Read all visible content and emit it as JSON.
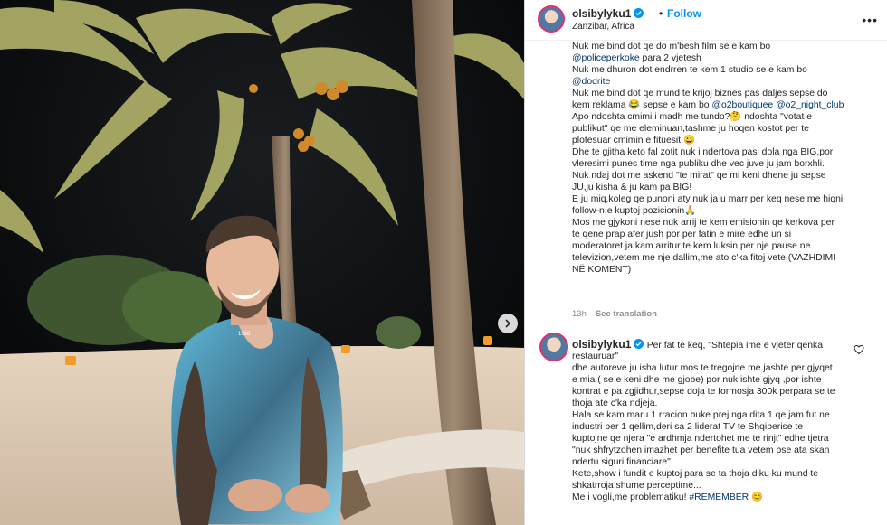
{
  "post": {
    "username": "olsibylyku1",
    "follow_label": "Follow",
    "location": "Zanzibar, Africa",
    "time": "13h",
    "see_translation": "See translation",
    "caption_lines": [
      [
        {
          "t": "Nuk me bind dot qe do m'besh film se e kam bo"
        }
      ],
      [
        {
          "t": "@policeperkoke",
          "m": true
        },
        {
          "t": " para 2 vjetesh"
        }
      ],
      [
        {
          "t": "Nuk me dhuron dot endrren te kem 1 studio se e kam bo"
        }
      ],
      [
        {
          "t": "@dodrite",
          "m": true
        }
      ],
      [
        {
          "t": "Nuk me bind dot qe mund te krijoj biznes pas daljes sepse do"
        }
      ],
      [
        {
          "t": "kem reklama 😂 sepse e kam bo "
        },
        {
          "t": "@o2boutiquee",
          "m": true
        },
        {
          "t": " "
        },
        {
          "t": "@o2_night_club",
          "m": true
        }
      ],
      [
        {
          "t": "Apo ndoshta cmimi i madh me tundo?🤔 ndoshta \"votat e"
        }
      ],
      [
        {
          "t": "publikut\" qe me eleminuan,tashme ju hoqen kostot per te"
        }
      ],
      [
        {
          "t": "plotesuar cmimin e fituesit!😀"
        }
      ],
      [
        {
          "t": "Dhe te gjitha keto fal zotit nuk i ndertova pasi dola nga BIG,por"
        }
      ],
      [
        {
          "t": "vleresimi punes time nga publiku dhe vec juve ju jam borxhli."
        }
      ],
      [
        {
          "t": "Nuk ndaj dot me askend \"te mirat\" qe mi keni dhene ju sepse"
        }
      ],
      [
        {
          "t": "JU,ju kisha & ju kam pa BIG!"
        }
      ],
      [
        {
          "t": "E ju miq,koleg qe punoni aty nuk ja u marr per keq nese me hiqni"
        }
      ],
      [
        {
          "t": "follow-n,e kuptoj pozicionin🙏"
        }
      ],
      [
        {
          "t": "Mos me gjykoni nese nuk arrij te kem emisionin qe kerkova per"
        }
      ],
      [
        {
          "t": "te qene prap afer jush por per fatin e mire edhe un si"
        }
      ],
      [
        {
          "t": "moderatoret ja kam arritur te kem luksin per nje pause ne"
        }
      ],
      [
        {
          "t": "televizion,vetem me nje dallim,me ato c'ka fitoj vete.(VAZHDIMI"
        }
      ],
      [
        {
          "t": "NË KOMENT)"
        }
      ]
    ]
  },
  "comment": {
    "username": "olsibylyku1",
    "lines": [
      [
        {
          "t": "Per fat te keq, \"Shtepia ime e vjeter qenka"
        }
      ],
      [
        {
          "t": "restauruar\""
        }
      ],
      [
        {
          "t": "dhe autoreve ju isha lutur mos te tregojne me jashte per gjyqet"
        }
      ],
      [
        {
          "t": "e mia ( se e keni dhe me gjobe) por nuk ishte gjyq ,por ishte"
        }
      ],
      [
        {
          "t": "kontrat e pa zgjidhur,sepse doja te formosja 300k perpara se te"
        }
      ],
      [
        {
          "t": "thoja ate c'ka ndjeja."
        }
      ],
      [
        {
          "t": "Hala se kam maru 1 rracion buke prej nga dita 1 qe jam fut ne"
        }
      ],
      [
        {
          "t": "industri per 1 qellim,deri sa 2 liderat TV te Shqiperise te"
        }
      ],
      [
        {
          "t": "kuptojne qe njera \"e ardhmja ndertohet me te rinjt\" edhe tjetra"
        }
      ],
      [
        {
          "t": "\"nuk shfrytzohen imazhet per benefite tua vetem pse ata skan"
        }
      ],
      [
        {
          "t": "ndertu siguri financiare\""
        }
      ],
      [
        {
          "t": "Kete,show i fundit e kuptoj para se ta thoja diku ku mund te"
        }
      ],
      [
        {
          "t": "shkatrroja shume perceptime..."
        }
      ],
      [
        {
          "t": "Me i vogli,me problematiku! "
        },
        {
          "t": "#REMEMBER",
          "m": true
        },
        {
          "t": " 😊"
        }
      ]
    ]
  },
  "photo": {
    "shirt_text": "1998"
  },
  "colors": {
    "accent": "#0095f6",
    "link": "#00376b",
    "verified": "#0095f6"
  },
  "icons": [
    "verified-badge-icon",
    "more-options-icon",
    "heart-icon",
    "next-arrow-icon"
  ]
}
